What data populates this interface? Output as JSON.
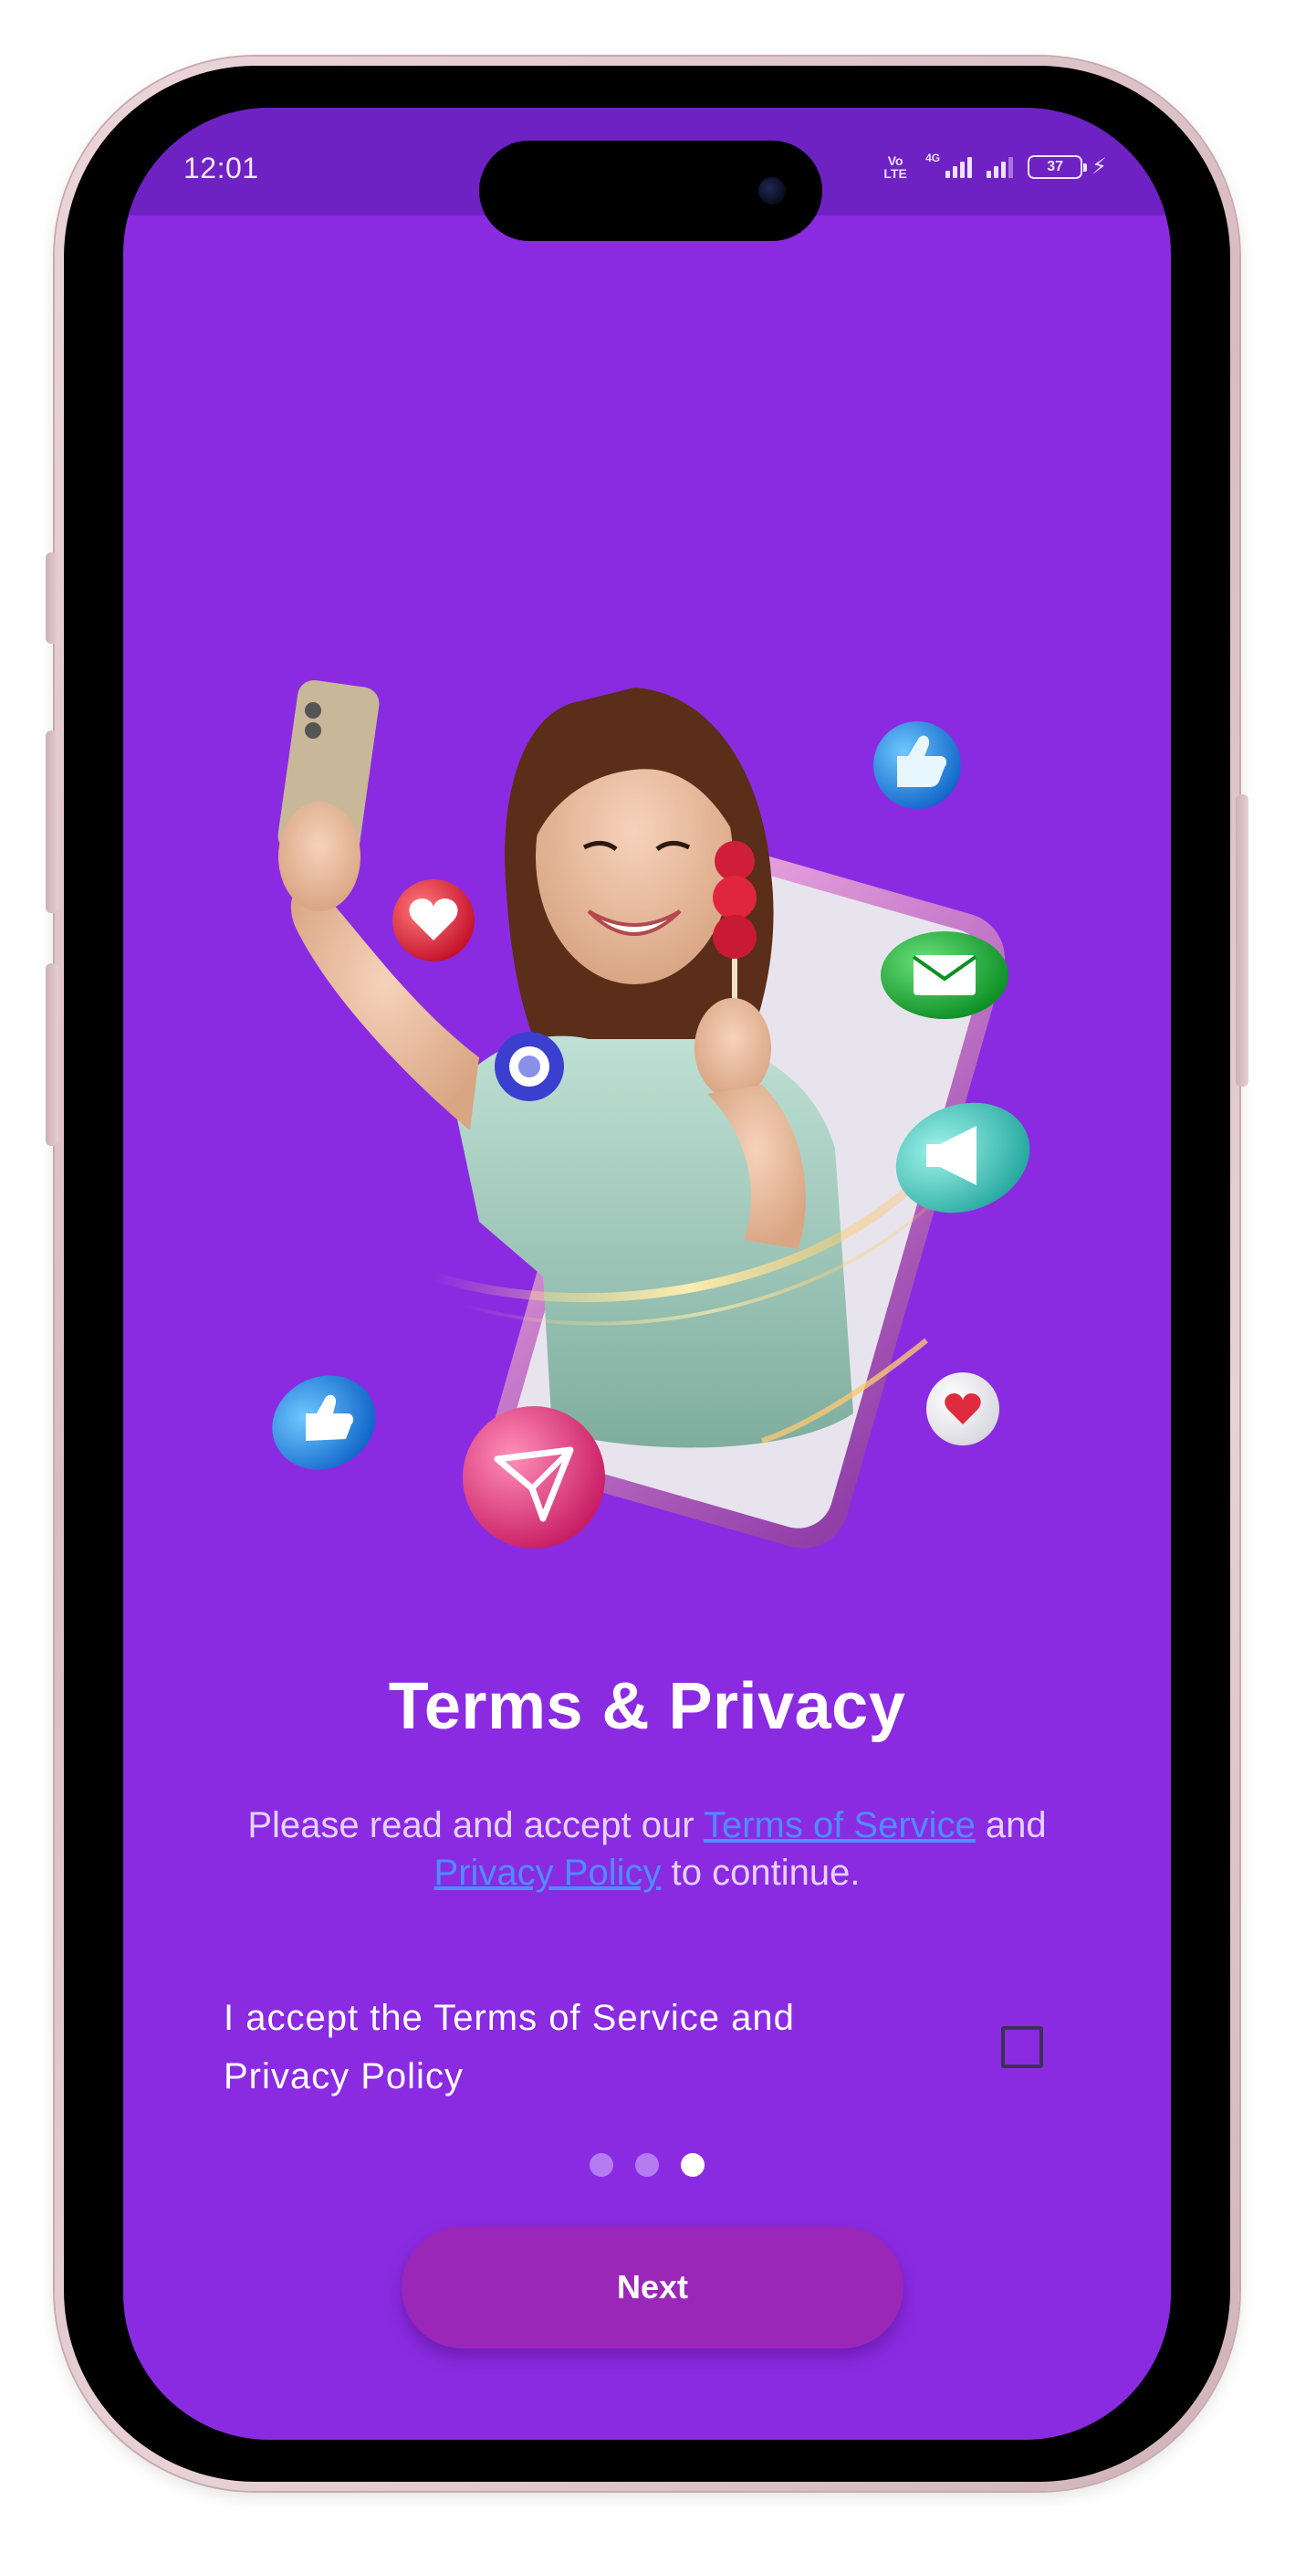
{
  "status_bar": {
    "time": "12:01",
    "volte_label": "VoLTE",
    "network_type": "4G",
    "battery_level": "37"
  },
  "hero": {
    "icons": [
      "phone-icon",
      "heart-icon",
      "like-icon",
      "mail-icon",
      "camera-icon",
      "megaphone-icon",
      "thumbs-up-icon",
      "send-icon",
      "heart-icon"
    ]
  },
  "content": {
    "title": "Terms & Privacy",
    "description_prefix": "Please read and accept our ",
    "terms_link": "Terms of Service",
    "description_middle": " and ",
    "privacy_link": "Privacy Policy",
    "description_suffix": " to continue.",
    "accept_label": "I accept the Terms of Service and Privacy Policy",
    "accepted": false
  },
  "pager": {
    "total": 3,
    "current": 3
  },
  "next_button": {
    "label": "Next"
  },
  "colors": {
    "background": "#8a2be2",
    "status_bar": "#6f22c3",
    "link": "#4f8dff",
    "button": "#9a27b8"
  }
}
